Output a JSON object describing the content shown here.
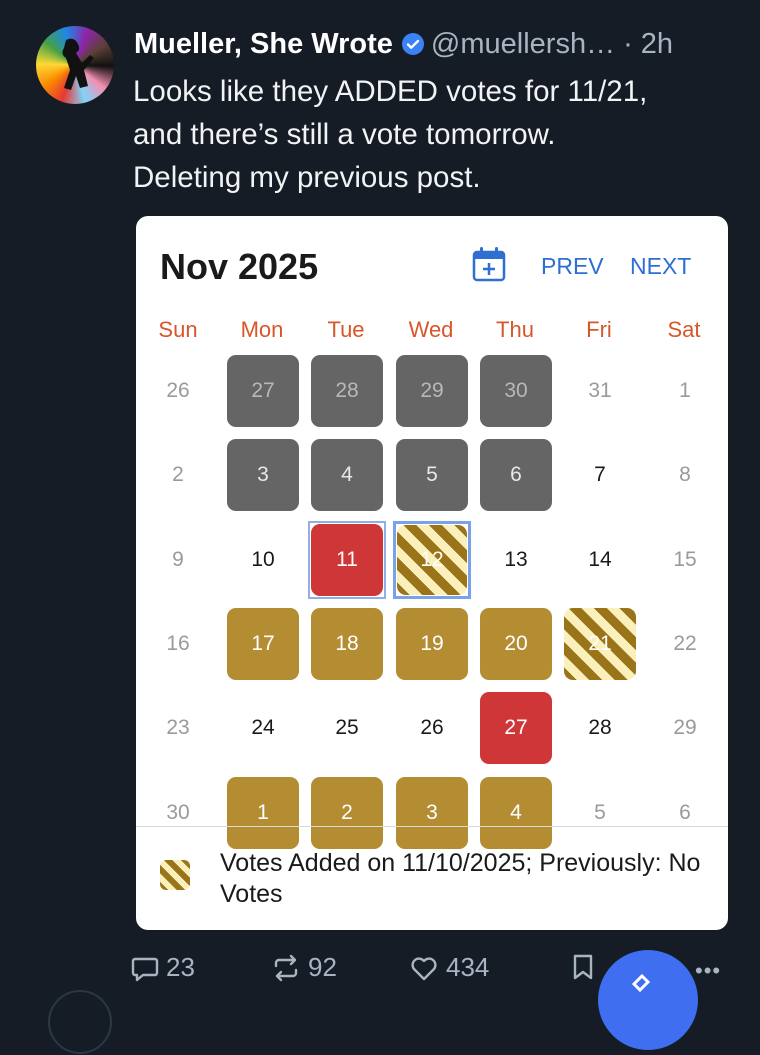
{
  "post": {
    "author": "Mueller, She Wrote",
    "handle": "@muellersh…",
    "separator": "·",
    "time": "2h",
    "text_lines": [
      "Looks like they ADDED votes for 11/21,",
      "and there’s still a vote tomorrow.",
      "Deleting my previous post."
    ],
    "icons": {
      "verified": "verified-badge-icon",
      "avatar": "avatar-image"
    }
  },
  "calendar": {
    "title": "Nov 2025",
    "prev_label": "PREV",
    "next_label": "NEXT",
    "weekday_labels": [
      "Sun",
      "Mon",
      "Tue",
      "Wed",
      "Thu",
      "Fri",
      "Sat"
    ],
    "weeks": [
      [
        "26",
        "27",
        "28",
        "29",
        "30",
        "31",
        "1"
      ],
      [
        "2",
        "3",
        "4",
        "5",
        "6",
        "7",
        "8"
      ],
      [
        "9",
        "10",
        "11",
        "12",
        "13",
        "14",
        "15"
      ],
      [
        "16",
        "17",
        "18",
        "19",
        "20",
        "21",
        "22"
      ],
      [
        "23",
        "24",
        "25",
        "26",
        "27",
        "28",
        "29"
      ],
      [
        "30",
        "1",
        "2",
        "3",
        "4",
        "5",
        "6"
      ]
    ],
    "legend_text": "Votes Added on 11/10/2025; Previously: No Votes",
    "colors": {
      "weekday_header": "#d7562a",
      "nav_link": "#2f6fd1",
      "past_day": "#656565",
      "vote_day": "#b48c32",
      "highlight_day": "#cf3638",
      "stripe_dark": "#9a7418",
      "stripe_light": "#fbf0bc"
    }
  },
  "actions": {
    "replies": "23",
    "reposts": "92",
    "likes": "434",
    "more": "•••"
  }
}
